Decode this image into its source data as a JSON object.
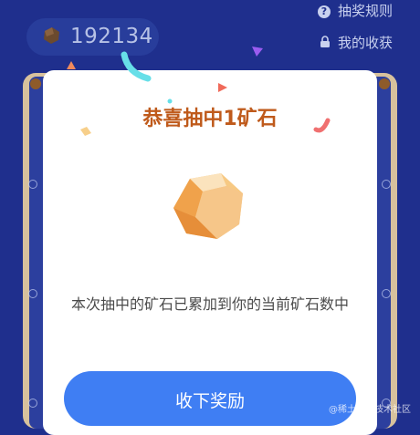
{
  "header": {
    "ore_count": "192134",
    "links": {
      "rules": "抽奖规则",
      "my_rewards": "我的收获"
    }
  },
  "modal": {
    "title": "恭喜抽中1矿石",
    "message": "本次抽中的矿石已累加到你的当前矿石数中",
    "button_label": "收下奖励"
  },
  "watermark": "@稀土掘金技术社区",
  "colors": {
    "background": "#1f2f8d",
    "accent_title": "#bf5a1b",
    "primary_button": "#3f7ef3",
    "ore": "#f0a24b"
  },
  "icons": {
    "ore": "ore-icon",
    "rules": "question-icon",
    "my_rewards": "lock-icon"
  }
}
